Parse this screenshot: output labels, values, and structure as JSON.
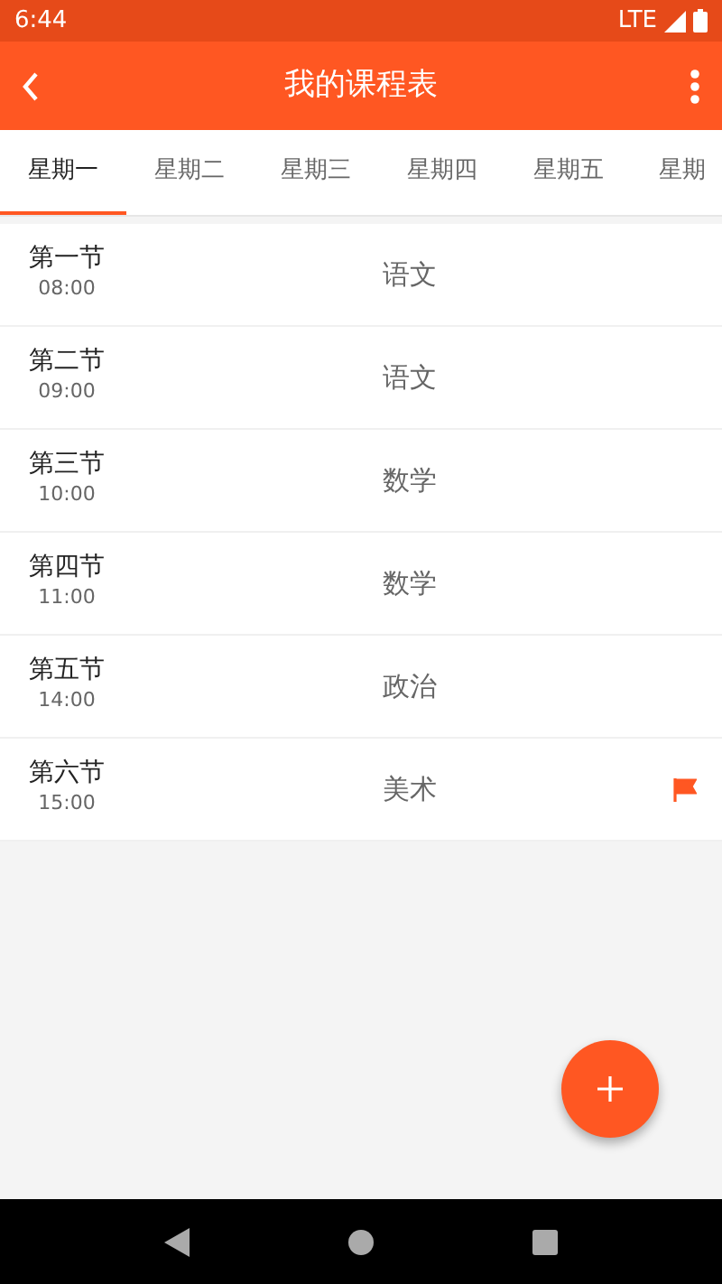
{
  "status_bar": {
    "time": "6:44",
    "network": "LTE"
  },
  "toolbar": {
    "title": "我的课程表"
  },
  "tabs": [
    {
      "label": "星期一",
      "selected": true
    },
    {
      "label": "星期二",
      "selected": false
    },
    {
      "label": "星期三",
      "selected": false
    },
    {
      "label": "星期四",
      "selected": false
    },
    {
      "label": "星期五",
      "selected": false
    },
    {
      "label": "星期",
      "selected": false
    }
  ],
  "lessons": [
    {
      "period": "第一节",
      "time": "08:00",
      "subject": "语文",
      "flagged": false
    },
    {
      "period": "第二节",
      "time": "09:00",
      "subject": "语文",
      "flagged": false
    },
    {
      "period": "第三节",
      "time": "10:00",
      "subject": "数学",
      "flagged": false
    },
    {
      "period": "第四节",
      "time": "11:00",
      "subject": "数学",
      "flagged": false
    },
    {
      "period": "第五节",
      "time": "14:00",
      "subject": "政治",
      "flagged": false
    },
    {
      "period": "第六节",
      "time": "15:00",
      "subject": "美术",
      "flagged": true
    }
  ]
}
